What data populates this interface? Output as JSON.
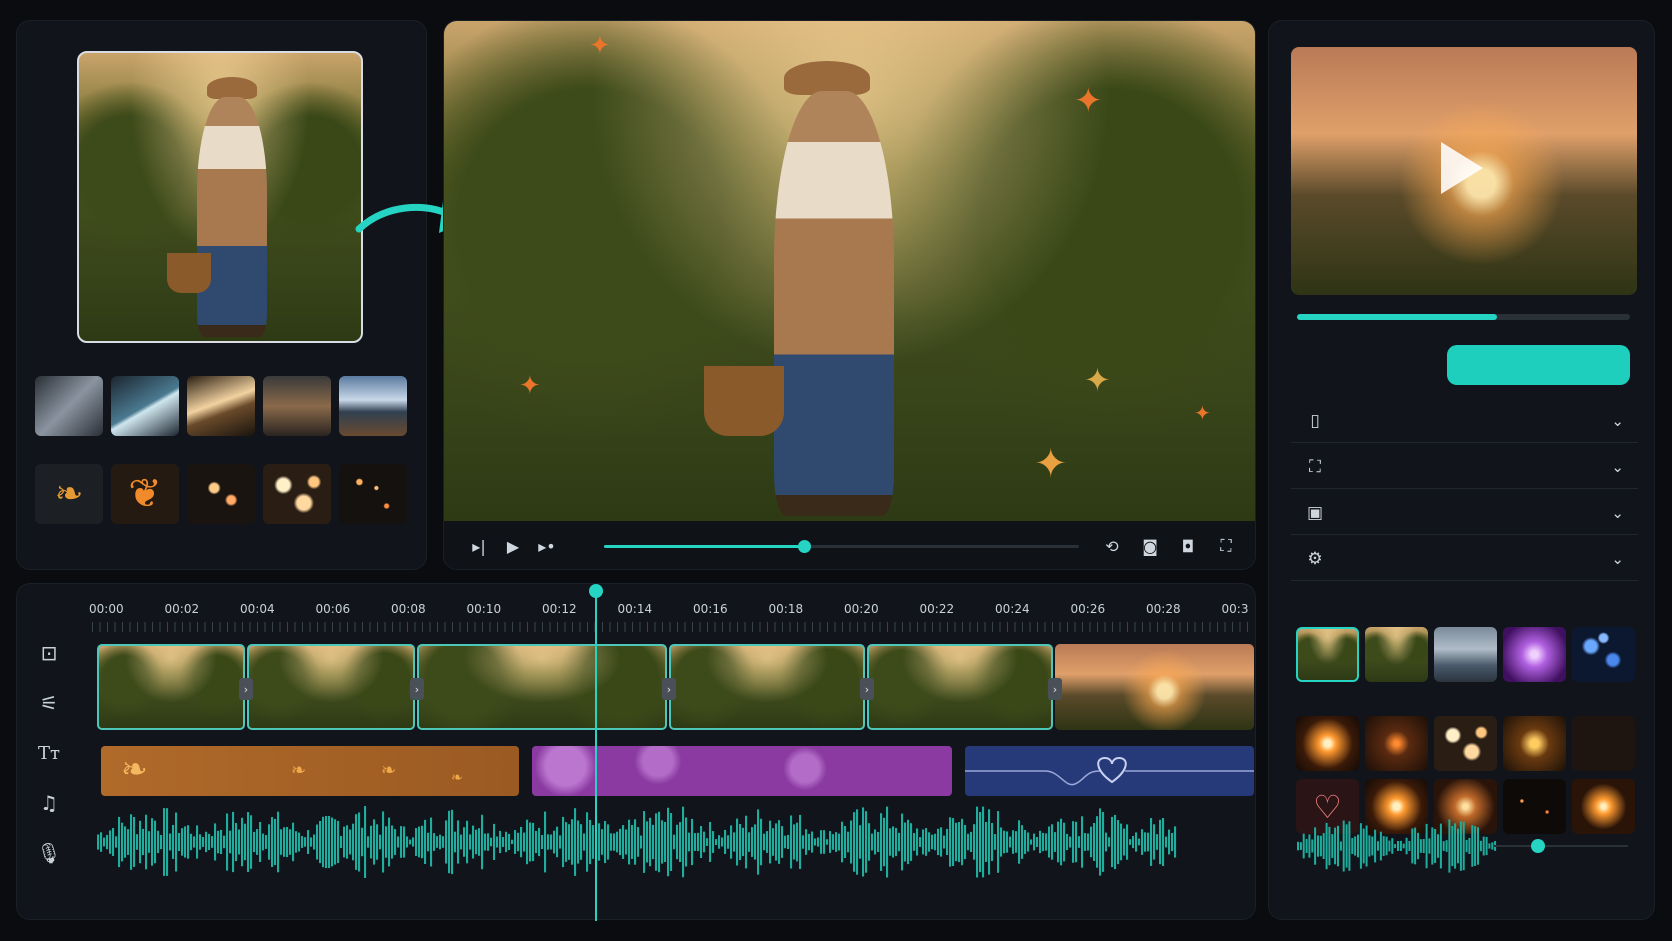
{
  "timeline": {
    "ticks": [
      "00:00",
      "00:02",
      "00:04",
      "00:06",
      "00:08",
      "00:10",
      "00:12",
      "00:14",
      "00:16",
      "00:18",
      "00:20",
      "00:22",
      "00:24",
      "00:26",
      "00:28",
      "00:3"
    ],
    "playhead_time": "00:13",
    "tools": [
      "media-icon",
      "adjust-icon",
      "text-icon",
      "music-icon",
      "microphone-icon"
    ]
  },
  "player": {
    "scrub_progress": 0.42
  },
  "export": {
    "progress": 0.6,
    "button_label": ""
  },
  "accordions": [
    {
      "icon": "file-icon"
    },
    {
      "icon": "frame-icon"
    },
    {
      "icon": "video-icon"
    },
    {
      "icon": "settings-icon"
    }
  ],
  "colors": {
    "accent": "#25d4c2",
    "panel": "#11151b",
    "background": "#0a0c10"
  }
}
